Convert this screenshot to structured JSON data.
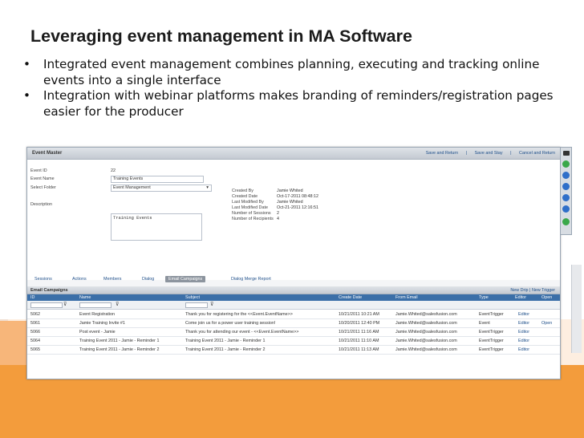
{
  "slide": {
    "title": "Leveraging event management in MA Software",
    "bullets": [
      "Integrated event management combines planning, executing and tracking online events into a single interface",
      "Integration with webinar platforms makes branding of reminders/registration pages easier for the producer"
    ],
    "bullet_symbol": "•"
  },
  "app": {
    "header_title": "Event Master",
    "header_actions": [
      "Save and Return",
      "Save and Stay",
      "Cancel and Return"
    ],
    "form": {
      "event_id_label": "Event ID",
      "event_id_value": "22",
      "event_name_label": "Event Name",
      "event_name_value": "Training Events",
      "select_folder_label": "Select Folder",
      "select_folder_value": "Event Management",
      "description_label": "Description",
      "description_value": "Training Events"
    },
    "meta": [
      {
        "label": "Created By",
        "value": "Jamie Whited"
      },
      {
        "label": "Created Date",
        "value": "Oct-17-2011 08:48:12"
      },
      {
        "label": "Last Modified By",
        "value": "Jamie Whited"
      },
      {
        "label": "Last Modified Date",
        "value": "Oct-21-2011 12:16:51"
      },
      {
        "label": "Number of Sessions",
        "value": "2"
      },
      {
        "label": "Number of Recipients",
        "value": "4"
      }
    ],
    "tabs": [
      "Sessions",
      "Actions",
      "Members",
      "Dialog",
      "Email Campaigns",
      "Dialog Merge Report"
    ],
    "active_tab": "Email Campaigns",
    "grid": {
      "title": "Email Campaigns",
      "actions": [
        "New Drip",
        "New Trigger"
      ],
      "columns": [
        "ID",
        "Name",
        "Subject",
        "Create Date",
        "From Email",
        "Type",
        "Editor",
        "Open"
      ],
      "rows": [
        [
          "5062",
          "Event Registration",
          "Thank you for registering for the <<Event.EventName>>",
          "10/21/2011 10:21 AM",
          "Jamie.Whited@salesfusion.com",
          "EventTrigger",
          "Editor",
          ""
        ],
        [
          "5061",
          "Jamie Training Invite #1",
          "Come join us for a power user training session!",
          "10/20/2011 12:40 PM",
          "Jamie.Whited@salesfusion.com",
          "Event",
          "Editor",
          "Open"
        ],
        [
          "5066",
          "Post event - Jamie",
          "Thank you for attending our event - <<Event.EventName>>",
          "10/21/2011 11:16 AM",
          "Jamie.Whited@salesfusion.com",
          "EventTrigger",
          "Editor",
          ""
        ],
        [
          "5064",
          "Training Event 2011 - Jamie - Reminder 1",
          "Training Event 2011 - Jamie - Reminder 1",
          "10/21/2011 11:10 AM",
          "Jamie.Whited@salesfusion.com",
          "EventTrigger",
          "Editor",
          ""
        ],
        [
          "5065",
          "Training Event 2011 - Jamie - Reminder 2",
          "Training Event 2011 - Jamie - Reminder 2",
          "10/21/2011 11:13 AM",
          "Jamie.Whited@salesfusion.com",
          "EventTrigger",
          "Editor",
          ""
        ]
      ]
    },
    "sidebar_icons": [
      "screen-icon",
      "chat-icon",
      "help-icon",
      "prev-icon",
      "next-icon",
      "refresh-icon",
      "settings-icon"
    ]
  },
  "colors": {
    "accent_orange": "#f39c3c",
    "grid_header_blue": "#3b6fa8",
    "link_blue": "#1d4e89"
  }
}
